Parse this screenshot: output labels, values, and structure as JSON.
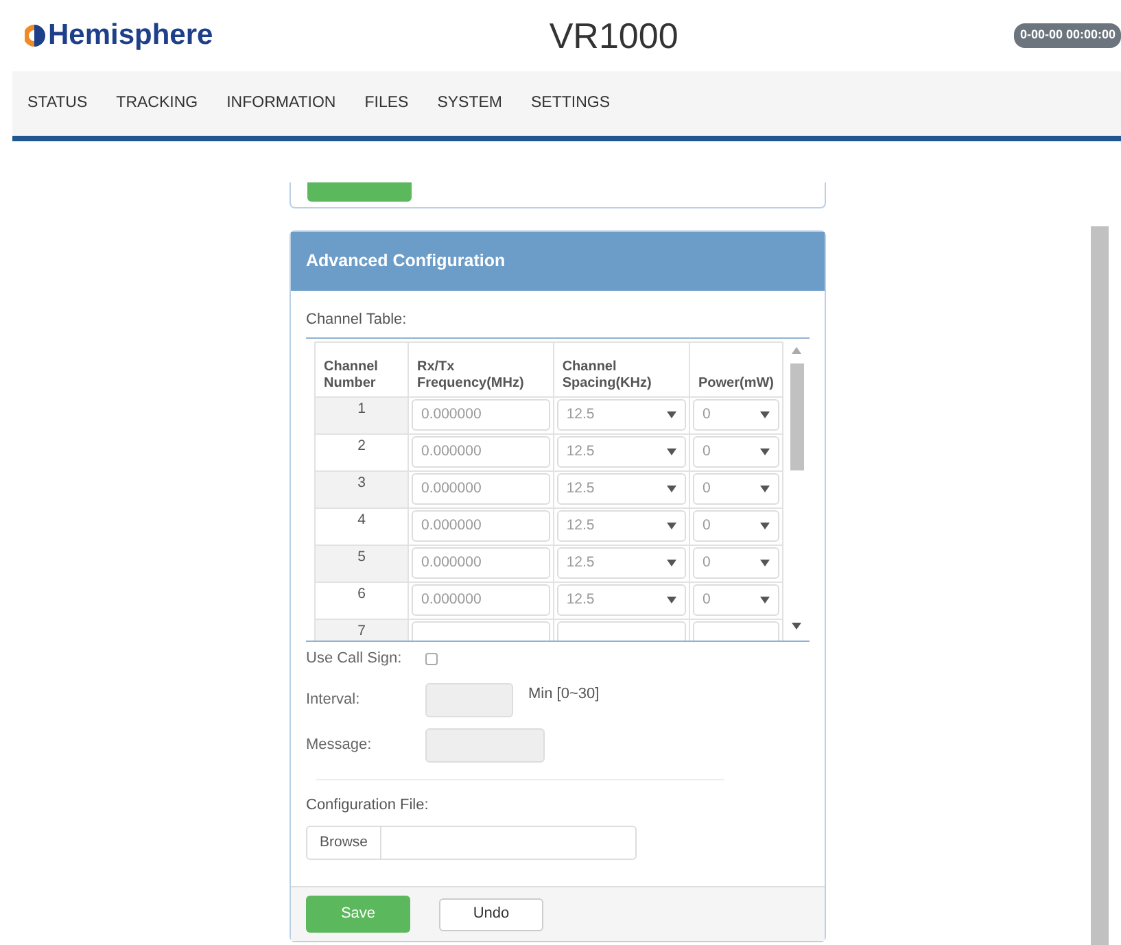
{
  "header": {
    "logo": "Hemisphere",
    "title": "VR1000",
    "clock": "0-00-00 00:00:00"
  },
  "nav": [
    {
      "label": "STATUS"
    },
    {
      "label": "TRACKING"
    },
    {
      "label": "INFORMATION"
    },
    {
      "label": "FILES"
    },
    {
      "label": "SYSTEM"
    },
    {
      "label": "SETTINGS"
    }
  ],
  "panel": {
    "title": "Advanced Configuration",
    "channel_table": {
      "label": "Channel Table:",
      "columns": [
        "Channel Number",
        "Rx/Tx Frequency(MHz)",
        "Channel Spacing(KHz)",
        "Power(mW)"
      ],
      "rows": [
        {
          "channel": "1",
          "frequency": "0.000000",
          "spacing": "12.5",
          "power": "0"
        },
        {
          "channel": "2",
          "frequency": "0.000000",
          "spacing": "12.5",
          "power": "0"
        },
        {
          "channel": "3",
          "frequency": "0.000000",
          "spacing": "12.5",
          "power": "0"
        },
        {
          "channel": "4",
          "frequency": "0.000000",
          "spacing": "12.5",
          "power": "0"
        },
        {
          "channel": "5",
          "frequency": "0.000000",
          "spacing": "12.5",
          "power": "0"
        },
        {
          "channel": "6",
          "frequency": "0.000000",
          "spacing": "12.5",
          "power": "0"
        },
        {
          "channel": "7"
        }
      ]
    },
    "use_call_sign": {
      "label": "Use Call Sign:",
      "checked": false
    },
    "interval": {
      "label": "Interval:",
      "disabled": true,
      "unit": "Min [0~30]"
    },
    "message": {
      "label": "Message:",
      "disabled": true
    },
    "config_file": {
      "label": "Configuration File:",
      "browse": "Browse"
    },
    "buttons": [
      {
        "label": "Save",
        "kind": "primary"
      },
      {
        "label": "Undo",
        "kind": "default"
      }
    ]
  }
}
